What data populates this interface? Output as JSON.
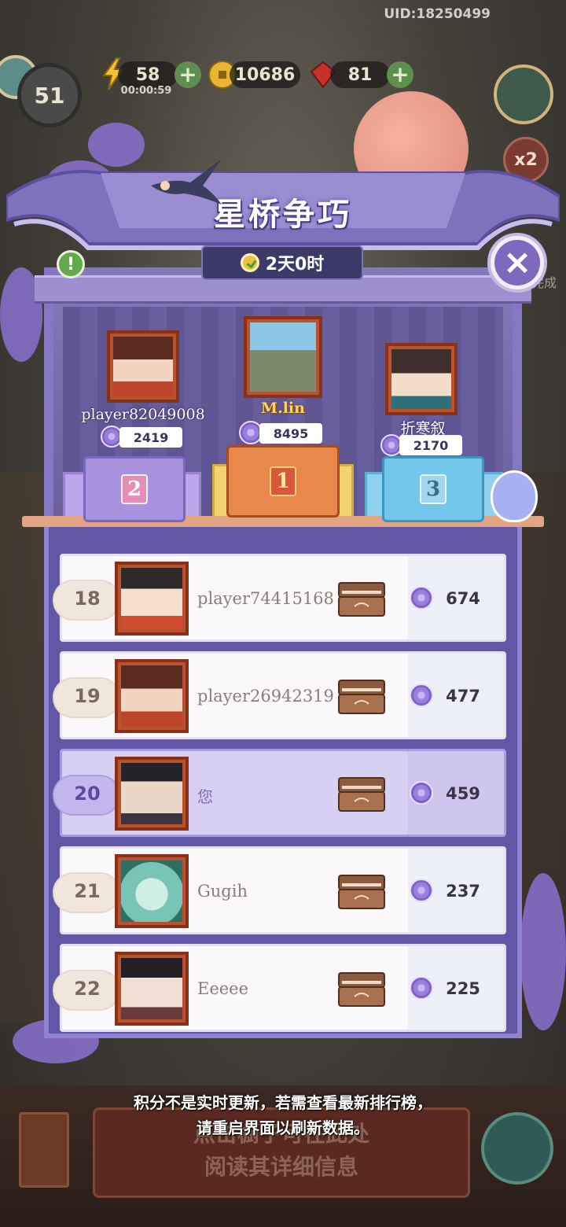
{
  "hud": {
    "uid": "UID:18250499",
    "level": "51",
    "energy": "58",
    "energy_timer": "00:00:59",
    "coins": "10686",
    "gems": "81",
    "multiplier": "x2",
    "side_text": "完成"
  },
  "event": {
    "title": "星桥争巧",
    "timer": "2天0时"
  },
  "podium": [
    {
      "place": "2",
      "name": "player82049008",
      "score": "2419"
    },
    {
      "place": "1",
      "name": "M.lin",
      "score": "8495"
    },
    {
      "place": "3",
      "name": "折寒叙",
      "score": "2170"
    }
  ],
  "leaderboard": [
    {
      "rank": "18",
      "name": "player74415168",
      "score": "674"
    },
    {
      "rank": "19",
      "name": "player26942319",
      "score": "477"
    },
    {
      "rank": "20",
      "name": "您",
      "score": "459"
    },
    {
      "rank": "21",
      "name": "Gugih",
      "score": "237"
    },
    {
      "rank": "22",
      "name": "Eeeee",
      "score": "225"
    }
  ],
  "notice": {
    "line1": "积分不是实时更新，若需查看最新排行榜，",
    "line2": "请重启界面以刷新数据。"
  },
  "background": {
    "faded_line1": "点击橱子可在此处",
    "faded_line2": "阅读其详细信息"
  },
  "colors": {
    "panel_purple": "#6256a6",
    "gold": "#ffd45a",
    "highlight_row": "#d8d0f3"
  }
}
